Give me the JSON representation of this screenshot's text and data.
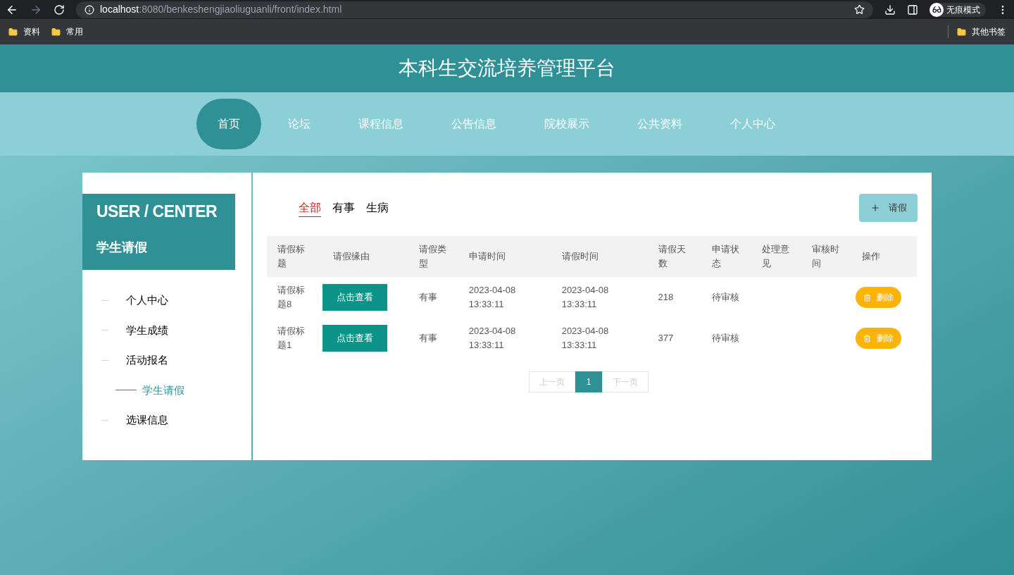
{
  "browser": {
    "url_host": "localhost",
    "url_rest": ":8080/benkeshengjiaoliuguanli/front/index.html",
    "profile": "无痕模式",
    "bookmarks": [
      "资料",
      "常用"
    ],
    "other_bookmarks": "其他书签"
  },
  "site_title": "本科生交流培养管理平台",
  "nav": [
    {
      "label": "首页",
      "selected": true
    },
    {
      "label": "论坛",
      "selected": false
    },
    {
      "label": "课程信息",
      "selected": false
    },
    {
      "label": "公告信息",
      "selected": false
    },
    {
      "label": "院校展示",
      "selected": false
    },
    {
      "label": "公共资料",
      "selected": false
    },
    {
      "label": "个人中心",
      "selected": false
    }
  ],
  "sidebar": {
    "heading": "USER / CENTER",
    "subheading": "学生请假",
    "items": [
      {
        "label": "个人中心",
        "selected": false
      },
      {
        "label": "学生成绩",
        "selected": false
      },
      {
        "label": "活动报名",
        "selected": false
      },
      {
        "label": "学生请假",
        "selected": true
      },
      {
        "label": "选课信息",
        "selected": false
      }
    ]
  },
  "filters": [
    {
      "label": "全部",
      "selected": true
    },
    {
      "label": "有事",
      "selected": false
    },
    {
      "label": "生病",
      "selected": false
    }
  ],
  "add_button": "请假",
  "table": {
    "columns": [
      "请假标题",
      "请假缘由",
      "请假类型",
      "申请时间",
      "请假时间",
      "请假天数",
      "申请状态",
      "处理意见",
      "审核时间",
      "操作"
    ],
    "rows": [
      {
        "title": "请假标题8",
        "reason_button": "点击查看",
        "type": "有事",
        "apply_time": "2023-04-08 13:33:11",
        "leave_time": "2023-04-08 13:33:11",
        "days": "218",
        "status": "待审核",
        "delete_button": "删除"
      },
      {
        "title": "请假标题1",
        "reason_button": "点击查看",
        "type": "有事",
        "apply_time": "2023-04-08 13:33:11",
        "leave_time": "2023-04-08 13:33:11",
        "days": "377",
        "status": "待审核",
        "delete_button": "删除"
      }
    ]
  },
  "pagination": {
    "prev": {
      "label": "上一页",
      "disabled": true
    },
    "pages": [
      {
        "label": "1",
        "selected": true
      }
    ],
    "next": {
      "label": "下一页",
      "disabled": true
    }
  }
}
